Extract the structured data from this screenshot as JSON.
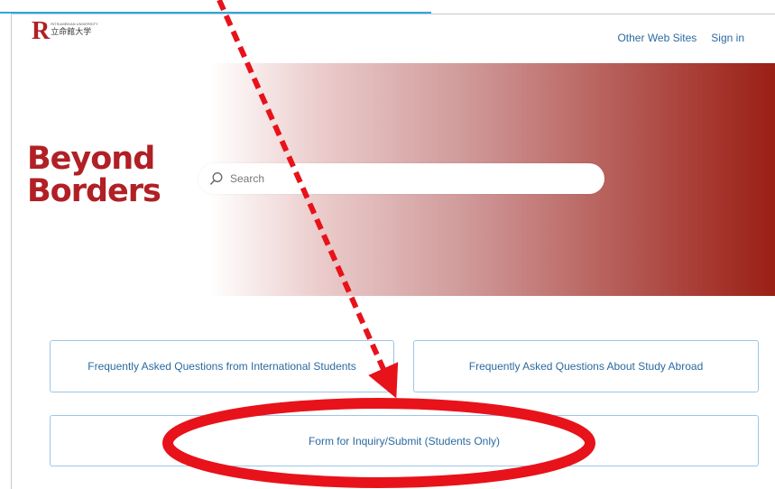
{
  "logo": {
    "mark": "R",
    "subtitle": "RITSUMEIKAN UNIVERSITY",
    "name": "立命館大学"
  },
  "nav": {
    "other_sites": "Other Web Sites",
    "sign_in": "Sign in"
  },
  "hero": {
    "title_line1": "Beyond",
    "title_line2": "Borders",
    "brand_color": "#b02025"
  },
  "search": {
    "placeholder": "Search",
    "icon": "search-icon"
  },
  "cards": [
    {
      "label": "Frequently Asked Questions from International Students"
    },
    {
      "label": "Frequently Asked Questions About Study Abroad"
    },
    {
      "label": "Form for Inquiry/Submit (Students Only)"
    }
  ],
  "annotation": {
    "color": "#e8121a"
  }
}
